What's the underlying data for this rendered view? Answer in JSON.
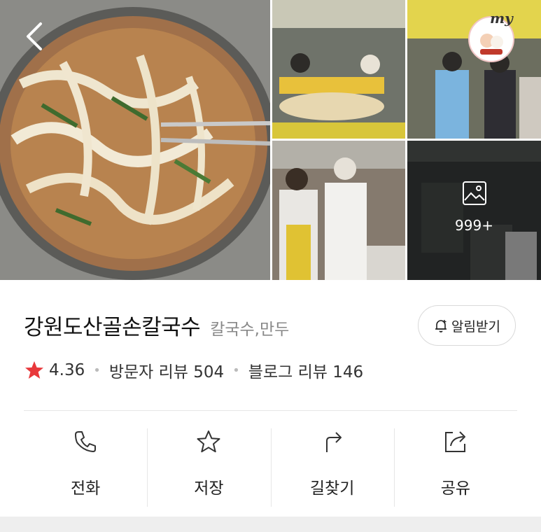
{
  "gallery": {
    "more_count": "999+",
    "badge": "my"
  },
  "place": {
    "name": "강원도산골손칼국수",
    "category": "칼국수,만두",
    "rating": "4.36",
    "visitor_review": "방문자 리뷰 504",
    "blog_review": "블로그 리뷰 146",
    "notify_label": "알림받기"
  },
  "actions": [
    {
      "icon": "phone-icon",
      "label": "전화"
    },
    {
      "icon": "star-outline-icon",
      "label": "저장"
    },
    {
      "icon": "directions-icon",
      "label": "길찾기"
    },
    {
      "icon": "share-icon",
      "label": "공유"
    }
  ],
  "colors": {
    "rating_star": "#e8383b",
    "text": "#111111",
    "muted": "#888888"
  }
}
